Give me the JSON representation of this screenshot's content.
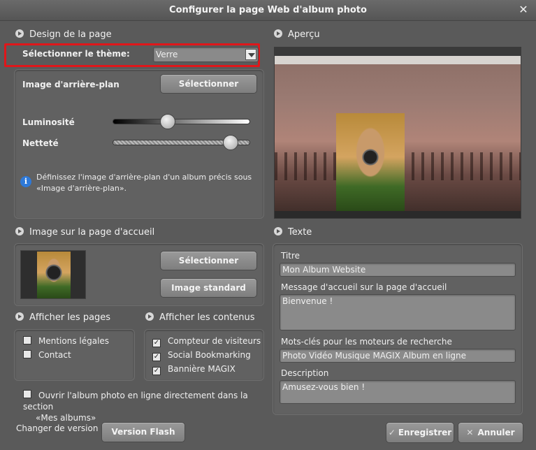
{
  "window": {
    "title": "Configurer la page Web d'album photo",
    "close": "✕"
  },
  "design": {
    "heading": "Design de la page",
    "theme_label": "Sélectionner le thème:",
    "theme_value": "Verre",
    "bg_label": "Image d'arrière-plan",
    "select_button": "Sélectionner",
    "brightness_label": "Luminosité",
    "brightness_value": 0.4,
    "sharpness_label": "Netteté",
    "sharpness_value": 0.86,
    "info_text": "Définissez l'image d'arrière-plan d'un album précis sous «Image d'arrière-plan»."
  },
  "preview": {
    "heading": "Aperçu"
  },
  "home_image": {
    "heading": "Image sur la page d'accueil",
    "select_button": "Sélectionner",
    "standard_button": "Image standard"
  },
  "pages": {
    "heading": "Afficher les pages",
    "items": [
      {
        "label": "Mentions légales",
        "checked": false
      },
      {
        "label": "Contact",
        "checked": false
      }
    ]
  },
  "contents": {
    "heading": "Afficher les contenus",
    "items": [
      {
        "label": "Compteur de visiteurs",
        "checked": true
      },
      {
        "label": "Social Bookmarking",
        "checked": true
      },
      {
        "label": "Bannière MAGIX",
        "checked": true
      }
    ]
  },
  "open_option": {
    "label_line1": "Ouvrir l'album photo en ligne directement dans la section",
    "label_line2": "«Mes albums»",
    "checked": false
  },
  "version": {
    "label": "Changer de version",
    "button": "Version Flash"
  },
  "text": {
    "heading": "Texte",
    "title_label": "Titre",
    "title_value": "Mon Album Website",
    "welcome_label": "Message d'accueil sur la page d'accueil",
    "welcome_value": "Bienvenue !",
    "keywords_label": "Mots-clés pour les moteurs de recherche",
    "keywords_value": "Photo Vidéo Musique MAGIX Album en ligne",
    "description_label": "Description",
    "description_value": "Amusez-vous bien !"
  },
  "footer": {
    "save": "Enregistrer",
    "cancel": "Annuler"
  }
}
